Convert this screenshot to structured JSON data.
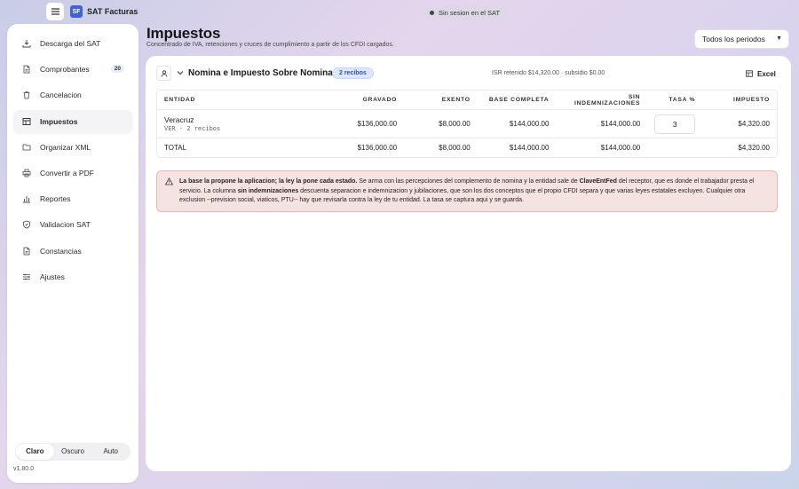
{
  "app": {
    "logo_text": "SF",
    "title": "SAT Facturas",
    "session_status": "Sin sesion en el SAT"
  },
  "sidebar": {
    "items": [
      {
        "label": "Descarga del SAT",
        "icon": "download-icon"
      },
      {
        "label": "Comprobantes",
        "icon": "document-icon",
        "badge": "20"
      },
      {
        "label": "Cancelacion",
        "icon": "trash-icon"
      },
      {
        "label": "Impuestos",
        "icon": "table-icon",
        "active": true
      },
      {
        "label": "Organizar XML",
        "icon": "folder-icon"
      },
      {
        "label": "Convertir a PDF",
        "icon": "printer-icon"
      },
      {
        "label": "Reportes",
        "icon": "bar-chart-icon"
      },
      {
        "label": "Validacion SAT",
        "icon": "shield-check-icon"
      },
      {
        "label": "Constancias",
        "icon": "document-icon"
      },
      {
        "label": "Ajustes",
        "icon": "sliders-icon"
      }
    ],
    "theme": {
      "options": [
        "Claro",
        "Oscuro",
        "Auto"
      ],
      "selected": "Claro"
    },
    "version": "v1.80.0"
  },
  "header": {
    "title": "Impuestos",
    "subtitle": "Concentrado de IVA, retenciones y cruces de cumplimiento a partir de los CFDI cargados.",
    "period_select": "Todos los periodos"
  },
  "section": {
    "title": "Nomina e Impuesto Sobre Nominas",
    "recibos_badge": "2 recibos",
    "isr_info": "ISR retenido $14,320.00 · subsidio $0.00",
    "excel_label": "Excel"
  },
  "table": {
    "headers": [
      "ENTIDAD",
      "GRAVADO",
      "EXENTO",
      "BASE COMPLETA",
      "SIN INDEMNIZACIONES",
      "TASA %",
      "IMPUESTO"
    ],
    "row": {
      "entity": "Veracruz",
      "entity_sub": "VER · 2 recibos",
      "gravado": "$136,000.00",
      "exento": "$8,000.00",
      "base_completa": "$144,000.00",
      "sin_indemnizaciones": "$144,000.00",
      "tasa": "3",
      "impuesto": "$4,320.00"
    },
    "total": {
      "label": "TOTAL",
      "gravado": "$136,000.00",
      "exento": "$8,000.00",
      "base_completa": "$144,000.00",
      "sin_indemnizaciones": "$144,000.00",
      "impuesto": "$4,320.00"
    }
  },
  "warning": {
    "bold_lead": "La base la propone la aplicacion; la ley la pone cada estado.",
    "text_1": " Se arma con las percepciones del complemento de nomina y la entidad sale de ",
    "bold_field": "ClaveEntFed",
    "text_2": " del receptor, que es donde el trabajador presta el servicio. La columna ",
    "bold_col": "sin indemnizaciones",
    "text_3": " descuenta separacion e indemnizacion y jubilaciones, que son los dos conceptos que el propio CFDI separa y que varias leyes estatales excluyen. Cualquier otra exclusion --prevision social, viaticos, PTU-- hay que revisarla contra la ley de tu entidad. La tasa se captura aqui y se guarda."
  }
}
